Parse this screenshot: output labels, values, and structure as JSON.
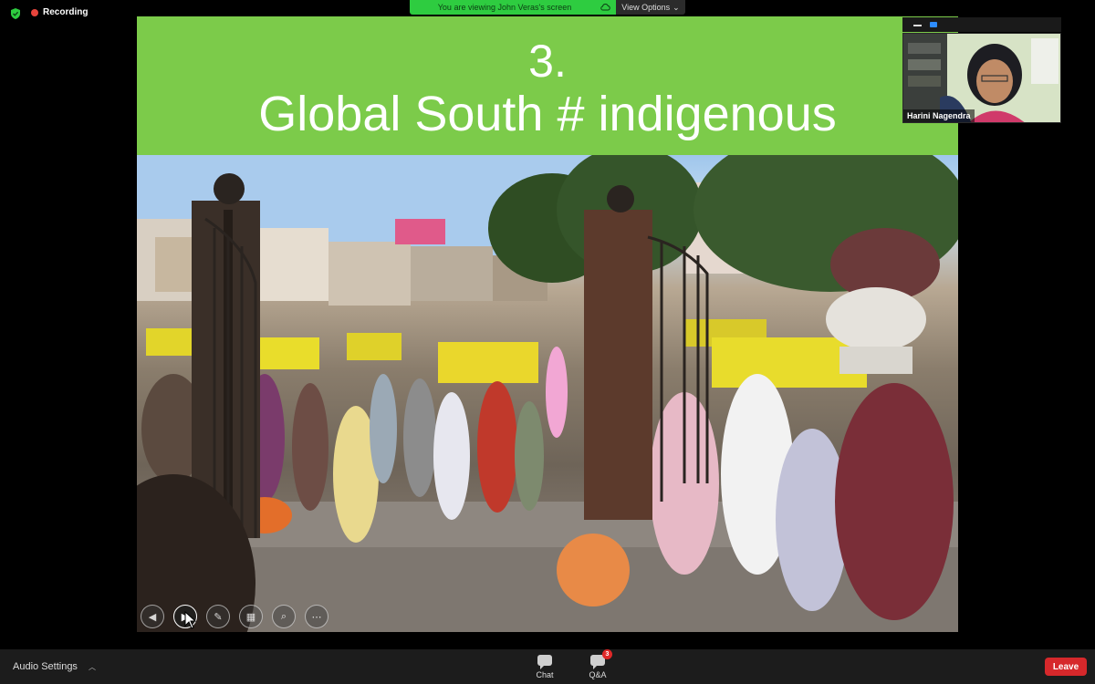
{
  "status": {
    "security_icon": "shield-check-icon",
    "recording_label": "Recording",
    "recording_color": "#e8453c"
  },
  "share_banner": {
    "text": "You are viewing John Veras's screen",
    "view_options_label": "View Options",
    "banner_color": "#2ecc40"
  },
  "slide": {
    "number": "3.",
    "title": "Global South # indigenous",
    "header_color": "#7ccb4a",
    "photo_icon": "street-market-photo",
    "controls": [
      {
        "name": "previous-slide-button",
        "icon": "chevron-left-icon",
        "glyph": "◀"
      },
      {
        "name": "next-slide-button",
        "icon": "chevron-right-icon",
        "glyph": "▶"
      },
      {
        "name": "pen-tool-button",
        "icon": "pen-icon",
        "glyph": "✎"
      },
      {
        "name": "slide-grid-button",
        "icon": "grid-icon",
        "glyph": "▦"
      },
      {
        "name": "zoom-button",
        "icon": "magnifier-icon",
        "glyph": "⌕"
      },
      {
        "name": "more-options-button",
        "icon": "ellipsis-icon",
        "glyph": "⋯"
      }
    ]
  },
  "participant": {
    "name": "Harini Nagendra"
  },
  "bottom_bar": {
    "audio_settings_label": "Audio Settings",
    "chat_label": "Chat",
    "qa_label": "Q&A",
    "qa_badge": "3",
    "leave_label": "Leave",
    "leave_color": "#d6282b"
  }
}
